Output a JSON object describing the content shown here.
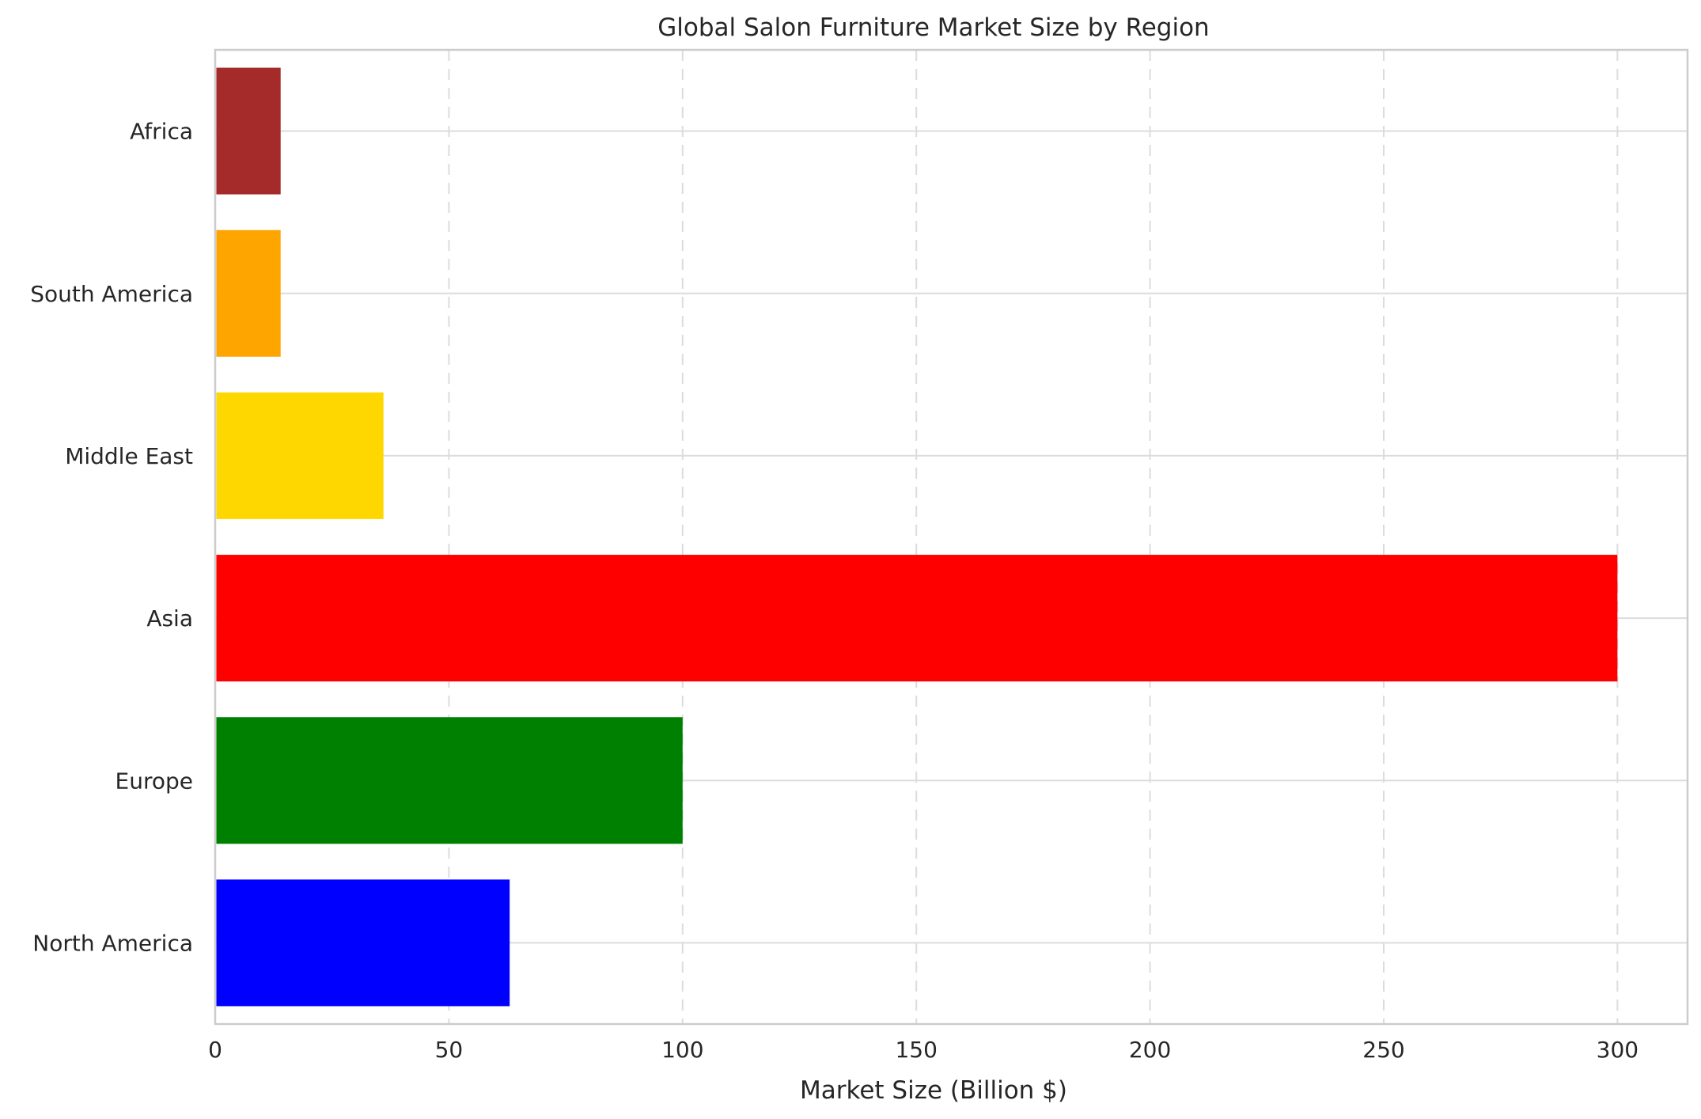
{
  "chart_data": {
    "type": "bar",
    "orientation": "horizontal",
    "title": "Global Salon Furniture Market Size by Region",
    "xlabel": "Market Size (Billion $)",
    "ylabel": "",
    "categories": [
      "North America",
      "Europe",
      "Asia",
      "Middle East",
      "South America",
      "Africa"
    ],
    "values": [
      63,
      100,
      300,
      36,
      14,
      14
    ],
    "colors": [
      "#0000ff",
      "#008000",
      "#ff0000",
      "#ffd700",
      "#ffa500",
      "#a52a2a"
    ],
    "xlim": [
      0,
      315
    ],
    "xticks": [
      0,
      50,
      100,
      150,
      200,
      250,
      300
    ],
    "grid": true
  }
}
